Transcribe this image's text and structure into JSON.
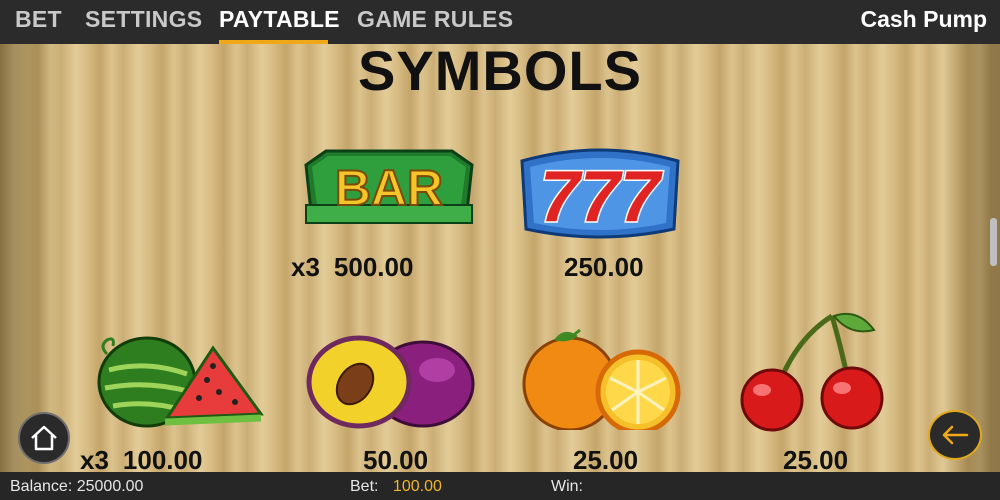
{
  "nav": {
    "tabs": [
      {
        "label": "BET"
      },
      {
        "label": "SETTINGS"
      },
      {
        "label": "PAYTABLE"
      },
      {
        "label": "GAME RULES"
      }
    ],
    "active_tab": "PAYTABLE",
    "game_title": "Cash Pump"
  },
  "paytable": {
    "heading": "SYMBOLS",
    "symbols": [
      {
        "name": "bar",
        "image_text": "BAR",
        "multiplier": "x3",
        "payout": "500.00"
      },
      {
        "name": "seven",
        "image_text": "777",
        "multiplier": "",
        "payout": "250.00"
      },
      {
        "name": "watermelon",
        "multiplier": "x3",
        "payout": "100.00"
      },
      {
        "name": "plum",
        "multiplier": "",
        "payout": "50.00"
      },
      {
        "name": "orange",
        "multiplier": "",
        "payout": "25.00"
      },
      {
        "name": "cherry",
        "multiplier": "",
        "payout": "25.00"
      }
    ]
  },
  "controls": {
    "home_icon": "home-icon",
    "back_icon": "arrow-left-icon",
    "accent_color": "#f0a818"
  },
  "status": {
    "balance_label": "Balance:",
    "balance_value": "25000.00",
    "bet_label": "Bet:",
    "bet_value": "100.00",
    "win_label": "Win:",
    "win_value": ""
  }
}
